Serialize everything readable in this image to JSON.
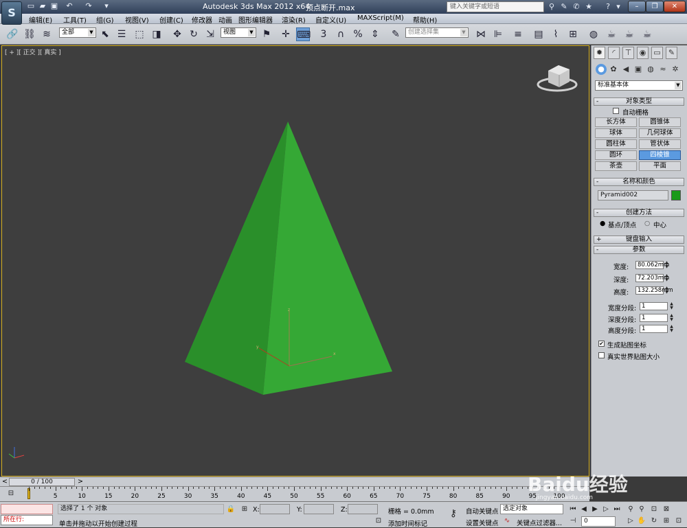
{
  "title_bar": {
    "app_title": "Autodesk 3ds Max  2012 x64",
    "file_name": "顶点断开.max",
    "search_placeholder": "键入关键字或短语",
    "logo_text": "S"
  },
  "menu": {
    "items": [
      "编辑(E)",
      "工具(T)",
      "组(G)",
      "视图(V)",
      "创建(C)",
      "修改器",
      "动画",
      "图形编辑器",
      "渲染(R)",
      "自定义(U)",
      "MAXScript(M)",
      "帮助(H)"
    ]
  },
  "toolbar": {
    "selection_filter": "全部",
    "reference_coord": "视图",
    "named_selection": "创建选择集",
    "snap_toggle": "3"
  },
  "viewport": {
    "label": "[ + ][ 正交 ][ 真实 ]",
    "object_color": "#2fa02f"
  },
  "command_panel": {
    "category": "标准基本体",
    "rollouts": {
      "object_type": "对象类型",
      "name_color": "名称和颜色",
      "creation_method": "创建方法",
      "keyboard_entry": "键盘输入",
      "parameters": "参数"
    },
    "autogrid_label": "自动栅格",
    "object_buttons": [
      "长方体",
      "圆锥体",
      "球体",
      "几何球体",
      "圆柱体",
      "管状体",
      "圆环",
      "四棱锥",
      "茶壶",
      "平面"
    ],
    "selected_object_button": "四棱锥",
    "object_name": "Pyramid002",
    "object_color": "#1a9a1a",
    "creation_options": [
      "基点/顶点",
      "中心"
    ],
    "params": {
      "width_label": "宽度:",
      "width_value": "80.062mm",
      "depth_label": "深度:",
      "depth_value": "72.203mm",
      "height_label": "高度:",
      "height_value": "132.258mm",
      "width_segs_label": "宽度分段:",
      "width_segs_value": "1",
      "depth_segs_label": "深度分段:",
      "depth_segs_value": "1",
      "height_segs_label": "高度分段:",
      "height_segs_value": "1"
    },
    "gen_mapping_label": "生成贴图坐标",
    "real_world_label": "真实世界贴图大小"
  },
  "timeline": {
    "frame_display": "0 / 100",
    "ticks": [
      "0",
      "5",
      "10",
      "15",
      "20",
      "25",
      "30",
      "35",
      "40",
      "45",
      "50",
      "55",
      "60",
      "65",
      "70",
      "75",
      "80",
      "85",
      "90",
      "95",
      "100"
    ]
  },
  "status": {
    "running_label": "所在行:",
    "selection_info": "选择了 1 个 对象",
    "prompt": "单击并拖动以开始创建过程",
    "x_label": "X:",
    "y_label": "Y:",
    "z_label": "Z:",
    "grid": "栅格 = 0.0mm",
    "add_time_tag": "添加时间标记",
    "auto_key": "自动关键点",
    "set_key": "设置关键点",
    "selected_objects": "选定对象",
    "key_filters": "关键点过滤器...",
    "frame_value": "0"
  },
  "watermark": {
    "text": "Baidu经验",
    "url": "jingyan.baidu.com"
  }
}
